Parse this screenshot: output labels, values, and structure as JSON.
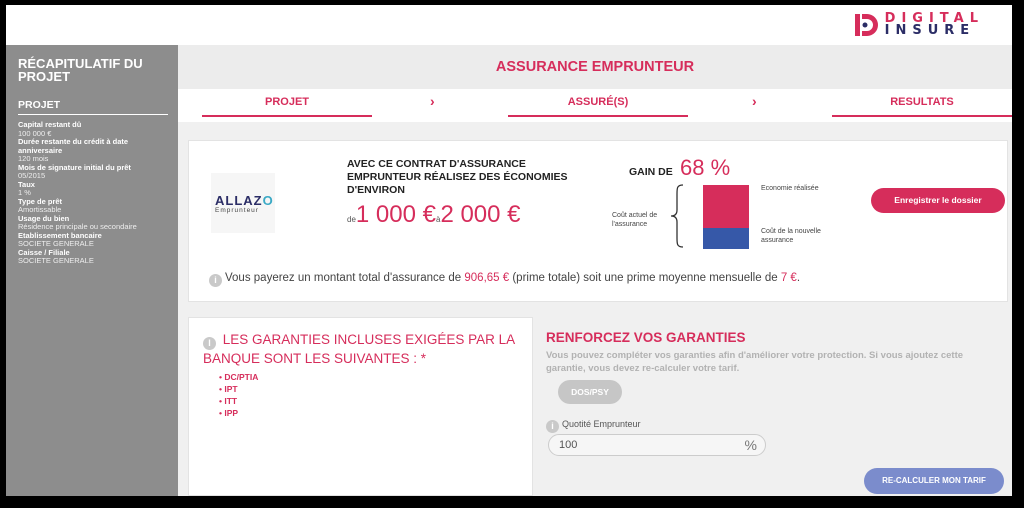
{
  "brand": {
    "line1": "DIGITAL",
    "line2": "INSURE",
    "color_pink": "#d62d5b",
    "color_navy": "#2b2d66"
  },
  "sidebar": {
    "title": "RÉCAPITULATIF DU PROJET",
    "section": "PROJET",
    "fields": [
      {
        "label": "Capital restant dû",
        "value": "100 000 €"
      },
      {
        "label": "Durée restante du crédit à date anniversaire",
        "value": "120 mois"
      },
      {
        "label": "Mois de signature initial du prêt",
        "value": "05/2015"
      },
      {
        "label": "Taux",
        "value": "1 %"
      },
      {
        "label": "Type de prêt",
        "value": "Amortissable"
      },
      {
        "label": "Usage du bien",
        "value": "Résidence principale ou secondaire"
      },
      {
        "label": "Etablissement bancaire",
        "value": "SOCIETE GENERALE"
      },
      {
        "label": "Caisse / Filiale",
        "value": "SOCIETE GENERALE"
      }
    ]
  },
  "main": {
    "title": "ASSURANCE EMPRUNTEUR",
    "steps": [
      "PROJET",
      "ASSURÉ(S)",
      "RESULTATS"
    ],
    "chevron": "›"
  },
  "offer": {
    "insurer_name_a": "ALLAZ",
    "insurer_name_b": "O",
    "insurer_sub": "Emprunteur",
    "headline": "AVEC CE CONTRAT D'ASSURANCE EMPRUNTEUR RÉALISEZ DES ÉCONOMIES D'ENVIRON",
    "range_de": "de",
    "range_min": "1 000 €",
    "range_a": "à",
    "range_max": "2 000 €",
    "gain_label": "GAIN DE",
    "gain_pct": "68 %",
    "gain_value": 0.68,
    "current_cost_label": "Coût actuel de l'assurance",
    "econ_label": "Economie réalisée",
    "new_cost_label": "Coût de la nouvelle assurance",
    "save_button": "Enregistrer le dossier",
    "info_before": "Vous payerez un montant total d'assurance de ",
    "info_total": "906,65 €",
    "info_middle": " (prime totale) soit une prime moyenne mensuelle de ",
    "info_monthly": "7 €",
    "info_end": "."
  },
  "guarantees": {
    "title": "LES GARANTIES INCLUSES EXIGÉES PAR LA BANQUE SONT LES SUIVANTES : *",
    "items": [
      "DC/PTIA",
      "IPT",
      "ITT",
      "IPP"
    ]
  },
  "reinforce": {
    "title": "RENFORCEZ VOS GARANTIES",
    "subtitle": "Vous pouvez compléter vos garanties afin d'améliorer votre protection. Si vous ajoutez cette garantie, vous devez re-calculer votre tarif.",
    "option": "DOS/PSY",
    "quotite_label": "Quotité Emprunteur",
    "quotite_value": "100",
    "quotite_unit": "%",
    "recalc_button": "RE-CALCULER MON TARIF"
  }
}
